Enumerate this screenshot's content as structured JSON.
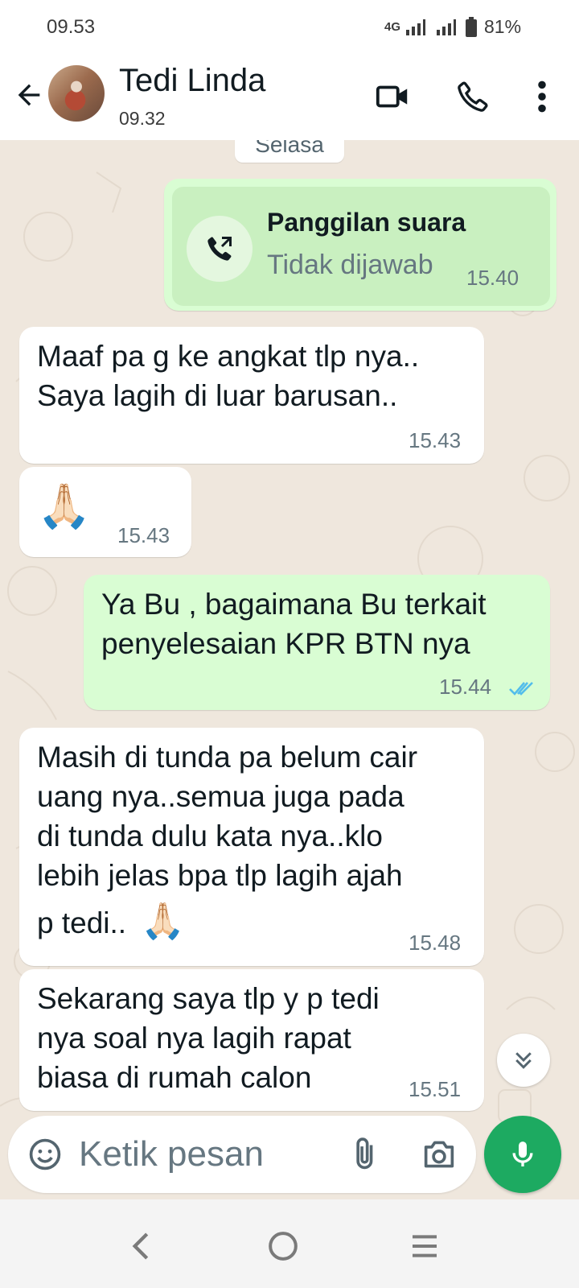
{
  "status_bar": {
    "time": "09.53",
    "network": "4G",
    "battery": "81%"
  },
  "header": {
    "contact_name": "Tedi Linda",
    "last_seen": "09.32"
  },
  "chat": {
    "date_separator": "Selasa",
    "call": {
      "title": "Panggilan suara",
      "status": "Tidak dijawab",
      "time": "15.40"
    },
    "messages": [
      {
        "direction": "incoming",
        "lines": [
          "Maaf pa g ke angkat tlp nya..",
          "Saya lagih di luar barusan.."
        ],
        "time": "15.43"
      },
      {
        "direction": "incoming",
        "emoji": "🙏🏻",
        "time": "15.43"
      },
      {
        "direction": "outgoing",
        "lines": [
          "Ya Bu , bagaimana Bu terkait",
          "penyelesaian KPR BTN nya"
        ],
        "time": "15.44",
        "read": true
      },
      {
        "direction": "incoming",
        "lines": [
          "Masih di tunda pa belum cair",
          "uang nya..semua juga pada",
          "di tunda dulu kata nya..klo",
          "lebih jelas bpa tlp lagih ajah",
          "p tedi.."
        ],
        "emoji": "🙏🏻",
        "time": "15.48"
      },
      {
        "direction": "incoming",
        "lines": [
          "Sekarang saya tlp y p tedi",
          "nya soal nya lagih rapat",
          "biasa di rumah calon"
        ],
        "time": "15.51"
      }
    ]
  },
  "composer": {
    "placeholder": "Ketik pesan"
  },
  "colors": {
    "outgoing_bubble": "#d9fdd3",
    "incoming_bubble": "#ffffff",
    "mic_button": "#1daa61",
    "read_ticks": "#53bdeb"
  }
}
